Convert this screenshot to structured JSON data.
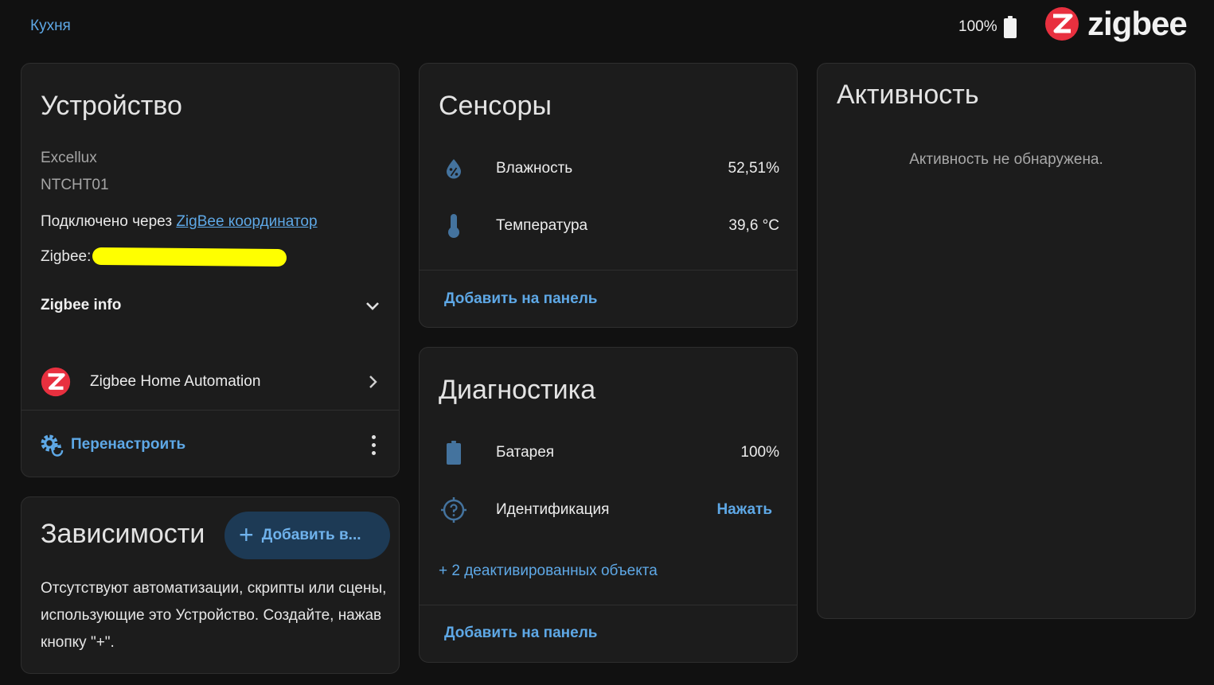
{
  "header": {
    "breadcrumb": "Кухня",
    "battery_level": "100%",
    "brand_word": "zigbee"
  },
  "device": {
    "title": "Устройство",
    "manufacturer": "Excellux",
    "model": "NTCHT01",
    "connected_prefix": "Подключено через ",
    "connected_link": "ZigBee координатор",
    "zigbee_label": "Zigbee:",
    "zigbee_info_label": "Zigbee info",
    "integration_label": "Zigbee Home Automation",
    "reconfigure_label": "Перенастроить"
  },
  "dependencies": {
    "title": "Зависимости",
    "add_label": "Добавить в...",
    "empty_text": "Отсутствуют автоматизации, скрипты или сцены, использующие это Устройство. Создайте, нажав кнопку \"+\"."
  },
  "sensors": {
    "title": "Сенсоры",
    "rows": [
      {
        "name": "Влажность",
        "value": "52,51%",
        "icon": "water-percent-icon"
      },
      {
        "name": "Температура",
        "value": "39,6 °C",
        "icon": "thermometer-icon"
      }
    ],
    "add_to_panel": "Добавить на панель"
  },
  "diagnostics": {
    "title": "Диагностика",
    "battery_name": "Батарея",
    "battery_value": "100%",
    "identify_name": "Идентификация",
    "identify_action": "Нажать",
    "disabled_entities": "+ 2 деактивированных объекта",
    "add_to_panel": "Добавить на панель"
  },
  "activity": {
    "title": "Активность",
    "empty_text": "Активность не обнаружена."
  },
  "colors": {
    "background": "#111111",
    "card": "#1c1c1c",
    "accent": "#5ea8e6",
    "zigbee_red": "#e8303f",
    "redaction": "#ffff00"
  }
}
